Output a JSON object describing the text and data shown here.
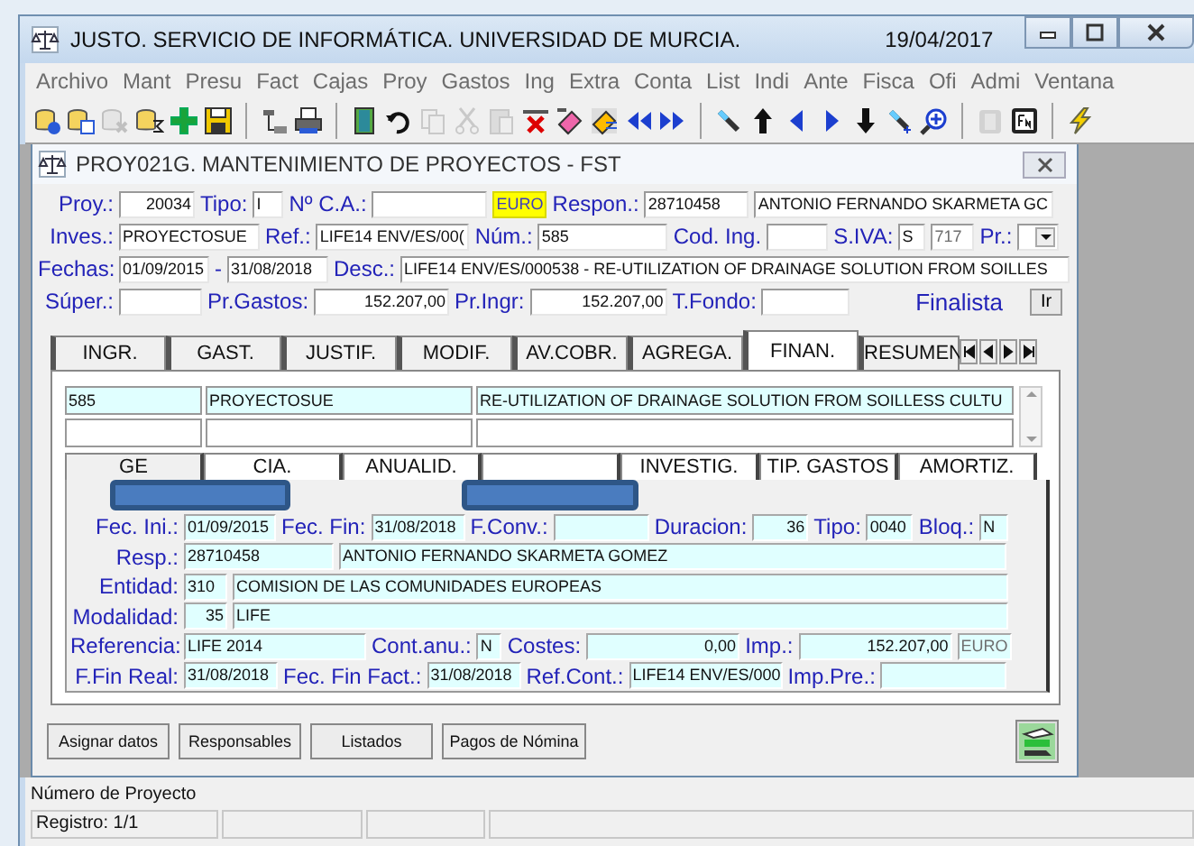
{
  "app": {
    "title": "JUSTO. SERVICIO DE INFORMÁTICA. UNIVERSIDAD DE MURCIA.",
    "date": "19/04/2017"
  },
  "menu": [
    "Archivo",
    "Mant",
    "Presu",
    "Fact",
    "Cajas",
    "Proy",
    "Gastos",
    "Ing",
    "Extra",
    "Conta",
    "List",
    "Indi",
    "Ante",
    "Fisca",
    "Ofi",
    "Admi",
    "Ventana"
  ],
  "toolbar": [
    [
      {
        "disabled": false
      },
      {
        "disabled": false
      },
      {
        "disabled": true
      },
      {
        "disabled": false
      },
      {
        "disabled": false
      },
      {
        "disabled": false
      }
    ],
    [
      {
        "disabled": false
      },
      {
        "disabled": false
      }
    ],
    [
      {
        "disabled": false
      },
      {
        "disabled": false
      },
      {
        "disabled": true
      },
      {
        "disabled": true
      },
      {
        "disabled": true
      },
      {
        "disabled": false
      },
      {
        "disabled": false
      },
      {
        "disabled": false
      },
      {
        "disabled": false
      },
      {
        "disabled": false
      }
    ],
    [
      {
        "disabled": false
      },
      {
        "disabled": false
      },
      {
        "disabled": false
      },
      {
        "disabled": false
      },
      {
        "disabled": false
      },
      {
        "disabled": false
      },
      {
        "disabled": false
      }
    ],
    [
      {
        "disabled": true
      },
      {
        "disabled": false
      }
    ],
    [
      {
        "disabled": false
      }
    ]
  ],
  "child_window": {
    "title": "PROY021G. MANTENIMIENTO DE PROYECTOS - FST"
  },
  "header_rows": [
    [
      {
        "kind": "label",
        "text": "Proy.:"
      },
      {
        "kind": "number",
        "value": "20034"
      },
      {
        "kind": "label",
        "text": "Tipo:"
      },
      {
        "kind": "field",
        "value": "I"
      },
      {
        "kind": "label",
        "text": "Nº C.A.:"
      },
      {
        "kind": "field"
      },
      {
        "kind": "currency",
        "value": "EURO"
      },
      {
        "kind": "label",
        "text": "Respon.:"
      },
      {
        "kind": "field",
        "value": "28710458"
      },
      {
        "kind": "field",
        "value": "ANTONIO FERNANDO SKARMETA GC"
      }
    ],
    [
      {
        "kind": "label",
        "text": "Inves.:"
      },
      {
        "kind": "field",
        "value": "PROYECTOSUE"
      },
      {
        "kind": "label",
        "text": "Ref.:"
      },
      {
        "kind": "field",
        "value": "LIFE14 ENV/ES/00("
      },
      {
        "kind": "label",
        "text": "Núm.:"
      },
      {
        "kind": "field",
        "value": "585"
      },
      {
        "kind": "label",
        "text": "Cod. Ing."
      },
      {
        "kind": "field"
      },
      {
        "kind": "label",
        "text": "S.IVA:"
      },
      {
        "kind": "field",
        "value": "S"
      },
      {
        "kind": "unit",
        "value": "717"
      },
      {
        "kind": "label",
        "text": "Pr.:"
      },
      {
        "kind": "dropdown"
      }
    ],
    [
      {
        "kind": "label",
        "text": "Fechas:"
      },
      {
        "kind": "field",
        "value": "01/09/2015"
      },
      {
        "kind": "label",
        "text": "-"
      },
      {
        "kind": "field",
        "value": "31/08/2018"
      },
      {
        "kind": "label",
        "text": "Desc.:"
      },
      {
        "kind": "field",
        "value": "LIFE14 ENV/ES/000538 - RE-UTILIZATION OF DRAINAGE SOLUTION FROM SOILLES"
      }
    ],
    [
      {
        "kind": "label",
        "text": "Súper.:"
      },
      {
        "kind": "field"
      },
      {
        "kind": "label",
        "text": "Pr.Gastos:"
      },
      {
        "kind": "number",
        "value": "152.207,00"
      },
      {
        "kind": "label",
        "text": "Pr.Ingr:"
      },
      {
        "kind": "number",
        "value": "152.207,00"
      },
      {
        "kind": "label",
        "text": "T.Fondo:"
      },
      {
        "kind": "field"
      },
      {
        "kind": "text",
        "text": "Finalista"
      },
      {
        "kind": "button",
        "text": "Ir"
      }
    ]
  ],
  "tabs": [
    {
      "label": "INGR.",
      "selected": false
    },
    {
      "label": "GAST.",
      "selected": false
    },
    {
      "label": "JUSTIF.",
      "selected": false
    },
    {
      "label": "MODIF.",
      "selected": false
    },
    {
      "label": "AV.COBR.",
      "selected": false
    },
    {
      "label": "AGREGA.",
      "selected": false
    },
    {
      "label": "FINAN.",
      "selected": true
    },
    {
      "label": "RESUMEN",
      "selected": false
    }
  ],
  "list_rows": [
    [
      "585",
      "PROYECTOSUE",
      "RE-UTILIZATION OF DRAINAGE SOLUTION FROM SOILLESS CULTU"
    ]
  ],
  "inner_tabs": [
    {
      "label": "GE",
      "selected": true,
      "redacted": true
    },
    {
      "label": "CIA.",
      "selected": false,
      "redacted": false
    },
    {
      "label": "ANUALID.",
      "selected": false,
      "redacted": false
    },
    {
      "selected": false,
      "redacted": true
    },
    {
      "label": "INVESTIG.",
      "selected": false,
      "redacted": false
    },
    {
      "label": "TIP. GASTOS",
      "selected": false,
      "redacted": false
    },
    {
      "label": "AMORTIZ.",
      "selected": false,
      "redacted": false
    }
  ],
  "inner_rows": [
    [
      {
        "kind": "label",
        "text": "Fec. Ini.:"
      },
      {
        "kind": "field",
        "value": "01/09/2015"
      },
      {
        "kind": "label",
        "text": "Fec. Fin:"
      },
      {
        "kind": "field",
        "value": "31/08/2018"
      },
      {
        "kind": "label",
        "text": "F.Conv.:"
      },
      {
        "kind": "field"
      },
      {
        "kind": "label",
        "text": "Duracion:"
      },
      {
        "kind": "number",
        "value": "36"
      },
      {
        "kind": "label",
        "text": "Tipo:"
      },
      {
        "kind": "field",
        "value": "0040"
      },
      {
        "kind": "label",
        "text": "Bloq.:"
      },
      {
        "kind": "field",
        "value": "N"
      }
    ],
    [
      {
        "kind": "label",
        "text": "Resp.:"
      },
      {
        "kind": "field",
        "value": "28710458"
      },
      {
        "kind": "field",
        "value": "ANTONIO FERNANDO SKARMETA GOMEZ"
      }
    ],
    [
      {
        "kind": "label",
        "text": "Entidad:"
      },
      {
        "kind": "field",
        "value": "310"
      },
      {
        "kind": "field",
        "value": "COMISION DE LAS COMUNIDADES EUROPEAS"
      }
    ],
    [
      {
        "kind": "label",
        "text": "Modalidad:"
      },
      {
        "kind": "number",
        "value": "35"
      },
      {
        "kind": "field",
        "value": "LIFE"
      }
    ],
    [
      {
        "kind": "label",
        "text": "Referencia:"
      },
      {
        "kind": "field",
        "value": "LIFE 2014"
      },
      {
        "kind": "label",
        "text": "Cont.anu.:"
      },
      {
        "kind": "field",
        "value": "N"
      },
      {
        "kind": "label",
        "text": "Costes:"
      },
      {
        "kind": "number",
        "value": "0,00"
      },
      {
        "kind": "label",
        "text": "Imp.:"
      },
      {
        "kind": "number",
        "value": "152.207,00"
      },
      {
        "kind": "unit",
        "value": "EURO"
      }
    ],
    [
      {
        "kind": "label",
        "text": "F.Fin Real:"
      },
      {
        "kind": "field",
        "value": "31/08/2018"
      },
      {
        "kind": "label",
        "text": "Fec. Fin Fact.:"
      },
      {
        "kind": "field",
        "value": "31/08/2018"
      },
      {
        "kind": "label",
        "text": "Ref.Cont.:"
      },
      {
        "kind": "field",
        "value": "LIFE14 ENV/ES/000"
      },
      {
        "kind": "label",
        "text": "Imp.Pre.:"
      },
      {
        "kind": "field"
      }
    ]
  ],
  "buttons": [
    "Asignar datos",
    "Responsables",
    "Listados",
    "Pagos de Nómina"
  ],
  "status": {
    "hint": "Número de Proyecto",
    "panels": [
      "Registro: 1/1"
    ]
  }
}
